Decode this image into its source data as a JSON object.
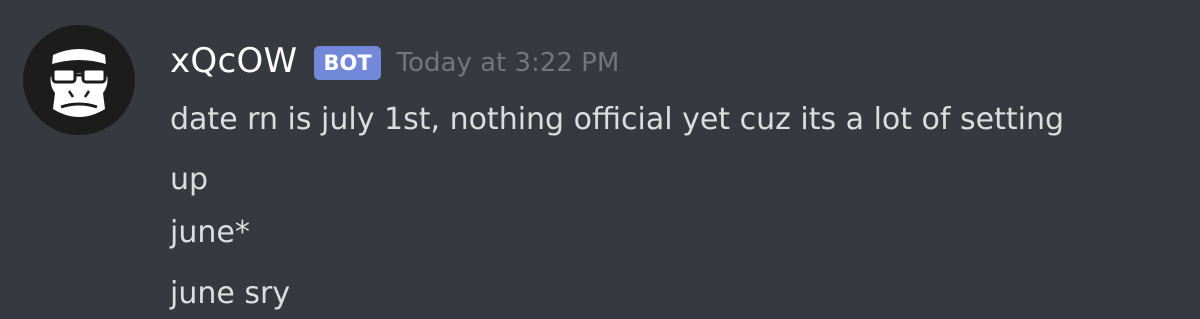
{
  "message": {
    "avatar_icon": "gorilla-face-icon",
    "username": "xQcOW",
    "bot_tag": "BOT",
    "timestamp": "Today at 3:22 PM",
    "lines": [
      "date rn is july 1st, nothing official yet cuz its a lot of setting",
      "up",
      "june*",
      "june sry"
    ]
  },
  "colors": {
    "background": "#36393f",
    "username": "#ffffff",
    "bot_tag": "#7289da",
    "timestamp": "#72767d",
    "text": "#dcddde"
  }
}
